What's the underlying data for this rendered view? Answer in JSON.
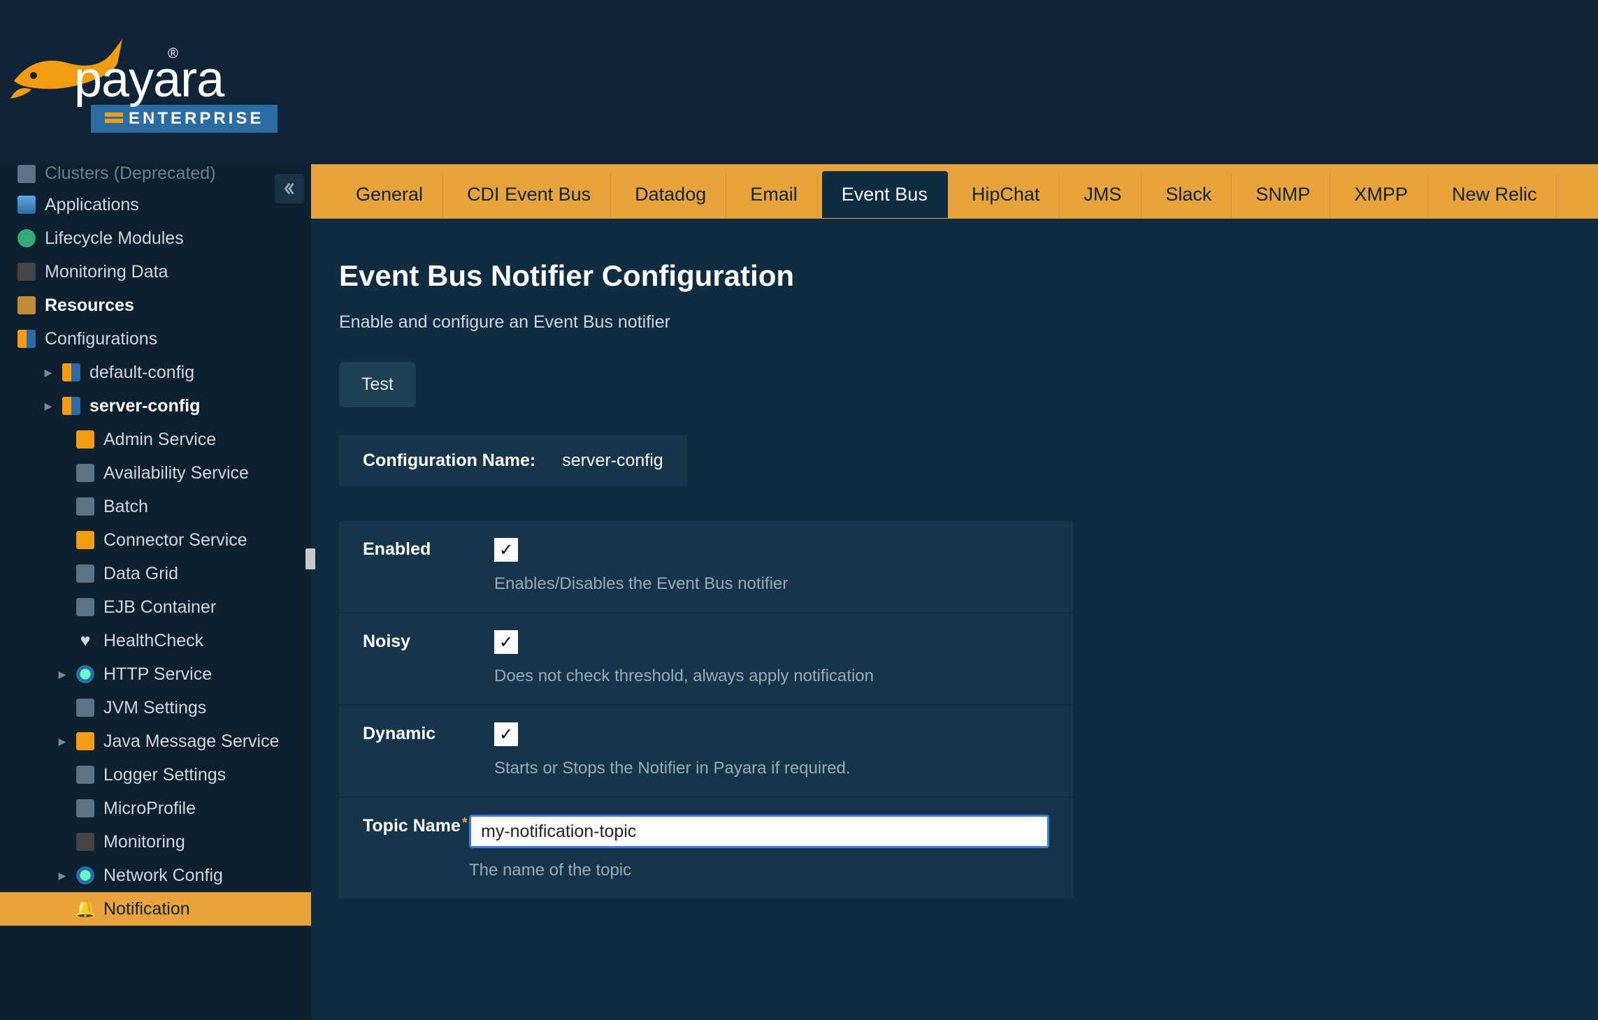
{
  "brand": {
    "name": "payara",
    "registered": "®",
    "edition": "ENTERPRISE"
  },
  "sidebar": {
    "items": [
      {
        "label": "Clusters (Deprecated)",
        "level": 1,
        "caret": "",
        "icon": "cluster-icon",
        "cut": true
      },
      {
        "label": "Applications",
        "level": 1,
        "caret": "",
        "icon": "applications-icon"
      },
      {
        "label": "Lifecycle Modules",
        "level": 1,
        "caret": "",
        "icon": "lifecycle-icon"
      },
      {
        "label": "Monitoring Data",
        "level": 1,
        "caret": "",
        "icon": "monitor-icon"
      },
      {
        "label": "Resources",
        "level": 1,
        "caret": "▶",
        "icon": "resources-icon",
        "bold": true
      },
      {
        "label": "Configurations",
        "level": 1,
        "caret": "▼",
        "icon": "config-icon"
      },
      {
        "label": "default-config",
        "level": 2,
        "caret": "▶",
        "icon": "config-item-icon"
      },
      {
        "label": "server-config",
        "level": 2,
        "caret": "▶",
        "icon": "config-item-icon",
        "bold": true
      },
      {
        "label": "Admin Service",
        "level": 3,
        "caret": "",
        "icon": "service-icon"
      },
      {
        "label": "Availability Service",
        "level": 3,
        "caret": "",
        "icon": "availability-icon"
      },
      {
        "label": "Batch",
        "level": 3,
        "caret": "",
        "icon": "batch-icon"
      },
      {
        "label": "Connector Service",
        "level": 3,
        "caret": "",
        "icon": "connector-icon"
      },
      {
        "label": "Data Grid",
        "level": 3,
        "caret": "",
        "icon": "datagrid-icon"
      },
      {
        "label": "EJB Container",
        "level": 3,
        "caret": "",
        "icon": "ejb-icon"
      },
      {
        "label": "HealthCheck",
        "level": 3,
        "caret": "",
        "icon": "heart-icon"
      },
      {
        "label": "HTTP Service",
        "level": 3,
        "caret": "▶",
        "icon": "globe-icon"
      },
      {
        "label": "JVM Settings",
        "level": 3,
        "caret": "",
        "icon": "jvm-icon"
      },
      {
        "label": "Java Message Service",
        "level": 3,
        "caret": "▶",
        "icon": "jms-icon"
      },
      {
        "label": "Logger Settings",
        "level": 3,
        "caret": "",
        "icon": "logger-icon"
      },
      {
        "label": "MicroProfile",
        "level": 3,
        "caret": "",
        "icon": "microprofile-icon"
      },
      {
        "label": "Monitoring",
        "level": 3,
        "caret": "",
        "icon": "monitoring-icon"
      },
      {
        "label": "Network Config",
        "level": 3,
        "caret": "▶",
        "icon": "globe-icon"
      },
      {
        "label": "Notification",
        "level": 3,
        "caret": "",
        "icon": "bell-icon",
        "selected": true
      }
    ]
  },
  "tabs": [
    "General",
    "CDI Event Bus",
    "Datadog",
    "Email",
    "Event Bus",
    "HipChat",
    "JMS",
    "Slack",
    "SNMP",
    "XMPP",
    "New Relic"
  ],
  "activeTab": "Event Bus",
  "page": {
    "title": "Event Bus Notifier Configuration",
    "description": "Enable and configure an Event Bus notifier",
    "testLabel": "Test",
    "configNameLabel": "Configuration Name:",
    "configNameValue": "server-config"
  },
  "form": {
    "enabled": {
      "label": "Enabled",
      "checked": true,
      "help": "Enables/Disables the Event Bus notifier"
    },
    "noisy": {
      "label": "Noisy",
      "checked": true,
      "help": "Does not check threshold, always apply notification"
    },
    "dynamic": {
      "label": "Dynamic",
      "checked": true,
      "help": "Starts or Stops the Notifier in Payara if required."
    },
    "topic": {
      "label": "Topic Name",
      "required": "*",
      "value": "my-notification-topic",
      "help": "The name of the topic"
    }
  }
}
